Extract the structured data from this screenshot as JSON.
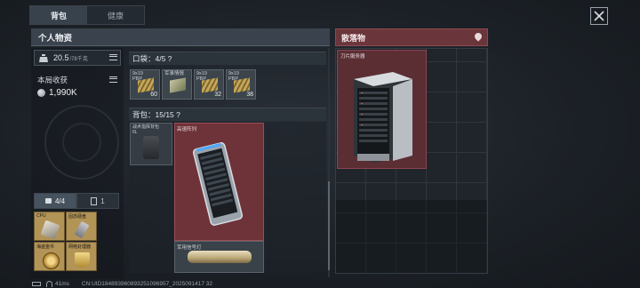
{
  "tabs": [
    {
      "label": "背包",
      "active": true
    },
    {
      "label": "健康",
      "active": false
    }
  ],
  "personal": {
    "title": "个人物资",
    "weight": {
      "value": "20.5",
      "max": "/78千克"
    },
    "income_label": "本局收获",
    "income_value": "1,990K",
    "bottom_tabs": [
      {
        "label": "4/4",
        "icon": "armor-icon"
      },
      {
        "label": "1",
        "icon": "card-icon"
      }
    ],
    "equipped": [
      {
        "label": "CPU"
      },
      {
        "label": "固态硬盘"
      },
      {
        "label": "海盗金币"
      },
      {
        "label": "网络处理器"
      }
    ]
  },
  "pocket": {
    "label": "口袋：4/5  ?",
    "items": [
      {
        "label": "9x19\nPBP",
        "count": "60"
      },
      {
        "label": "军事情报",
        "count": ""
      },
      {
        "label": "9x19\nPBP",
        "count": "32"
      },
      {
        "label": "9x19\nPBP",
        "count": "38"
      }
    ]
  },
  "backpack": {
    "label": "背包：15/15  ?",
    "items": [
      {
        "label": "战术指挥背包\n6L",
        "icon": "backpack-icon"
      },
      {
        "label": "高速阵列",
        "icon": "server-icon"
      },
      {
        "label": "军用信号灯",
        "icon": "flashlight-icon"
      }
    ]
  },
  "loot": {
    "title": "散落物",
    "item_label": "刀片服务器"
  },
  "status": {
    "ping": "41ms",
    "uid": "CN:UID184893960893251096957_2025091417 32"
  },
  "colors": {
    "rare_red": "#6e3339",
    "gold": "#b39457",
    "panel": "#3a434d"
  }
}
